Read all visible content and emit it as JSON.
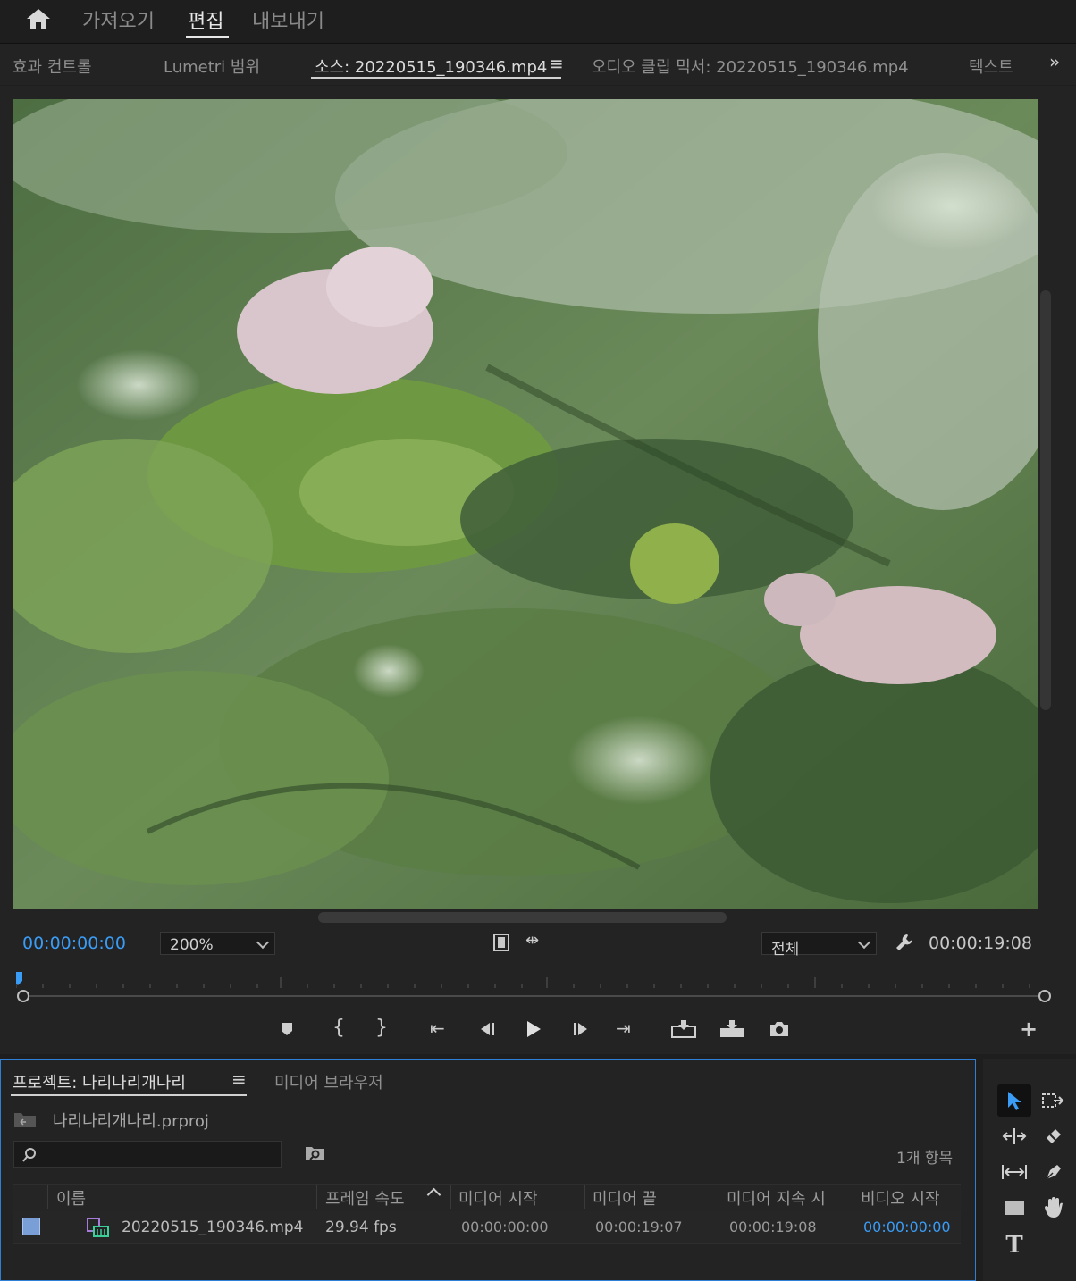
{
  "modes": {
    "home_icon": "home-icon",
    "import": "가져오기",
    "edit": "편집",
    "export": "내보내기"
  },
  "panel_tabs": {
    "effects": "효과 컨트롤",
    "lumetri": "Lumetri 범위",
    "source": "소스: 20220515_190346.mp4",
    "audio_mixer": "오디오 클립 믹서: 20220515_190346.mp4",
    "text": "텍스트",
    "overflow_icon": "double-chevron-right-icon"
  },
  "source_monitor": {
    "current_time": "00:00:00:00",
    "zoom": "200%",
    "resolution": "전체",
    "duration": "00:00:19:08"
  },
  "project": {
    "tab_title": "프로젝트: 나리나리개나리",
    "media_browser": "미디어 브라우저",
    "file_name": "나리나리개나리.prproj",
    "search_placeholder": "",
    "item_count": "1개 항목",
    "columns": {
      "name": "이름",
      "frame_rate": "프레임 속도",
      "media_start": "미디어 시작",
      "media_end": "미디어 끝",
      "media_duration": "미디어 지속 시",
      "video_start": "비디오 시작"
    },
    "rows": [
      {
        "label_color": "#7a9fd6",
        "name": "20220515_190346.mp4",
        "frame_rate": "29.94 fps",
        "media_start": "00:00:00:00",
        "media_end": "00:00:19:07",
        "media_duration": "00:00:19:08",
        "video_start": "00:00:00:00"
      }
    ]
  },
  "colors": {
    "accent_blue": "#3a9cf5",
    "panel_focus_border": "#2f7fd6"
  }
}
